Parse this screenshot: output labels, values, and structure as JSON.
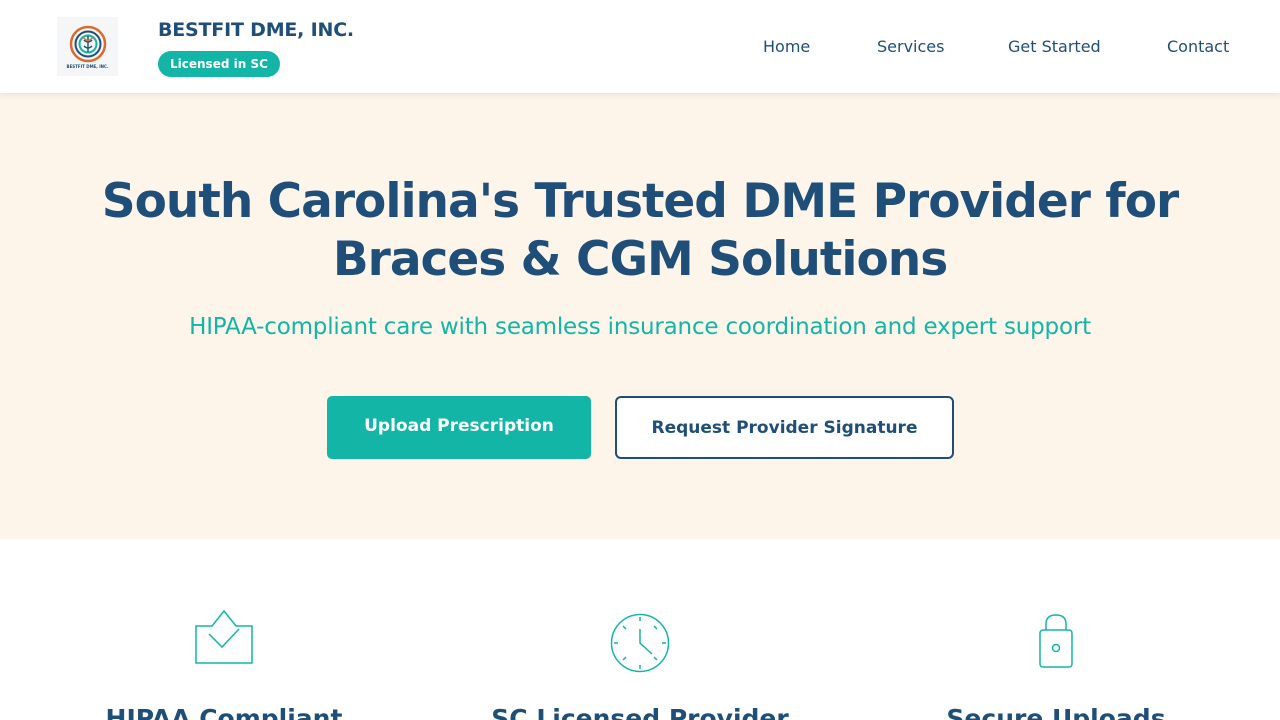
{
  "brand": {
    "name": "BESTFIT DME, INC.",
    "logo_text": "BESTFIT DME, INC.",
    "license_badge": "Licensed in SC"
  },
  "nav": {
    "items": [
      {
        "label": "Home"
      },
      {
        "label": "Services"
      },
      {
        "label": "Get Started"
      },
      {
        "label": "Contact"
      }
    ]
  },
  "hero": {
    "title_line1": "South Carolina's Trusted DME Provider for",
    "title_line2": "Braces & CGM Solutions",
    "subtitle": "HIPAA-compliant care with seamless insurance coordination and expert support",
    "primary_button": "Upload Prescription",
    "secondary_button": "Request Provider Signature"
  },
  "features": [
    {
      "title": "HIPAA Compliant",
      "icon": "shield-check-icon"
    },
    {
      "title": "SC Licensed Provider",
      "icon": "clock-icon"
    },
    {
      "title": "Secure Uploads",
      "icon": "lock-icon"
    }
  ],
  "colors": {
    "navy": "#1f4e79",
    "teal": "#13b5a6",
    "hero_bg": "#fdf4ea"
  }
}
